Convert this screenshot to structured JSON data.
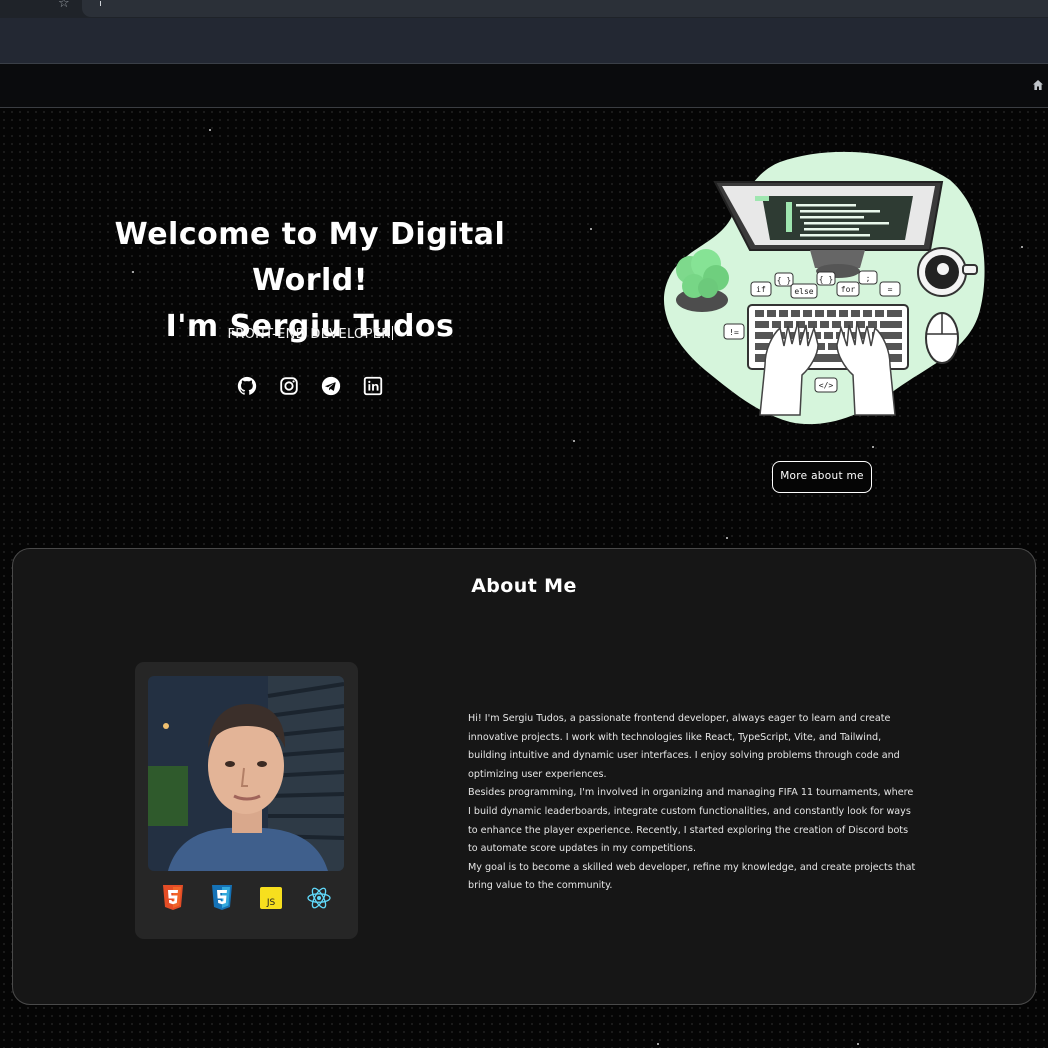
{
  "hero": {
    "title_line1": "Welcome to My Digital World!",
    "title_line2": "I'm Sergiu Tudos",
    "role": "FRONT-END DEVELOPER",
    "more_button": "More about me",
    "socials": [
      "github-icon",
      "instagram-icon",
      "telegram-icon",
      "linkedin-icon"
    ]
  },
  "illustration": {
    "code_words": [
      "{ }",
      "if",
      "else",
      "{ }",
      "for",
      ";",
      "=",
      "!=",
      "</>"
    ]
  },
  "about": {
    "title": "About Me",
    "tech_icons": [
      "html5-icon",
      "css3-icon",
      "javascript-icon",
      "react-icon"
    ],
    "paragraphs": [
      "Hi! I'm Sergiu Tudos, a passionate frontend developer, always eager to learn and create innovative projects. I work with technologies like React, TypeScript, Vite, and Tailwind, building intuitive and dynamic user interfaces. I enjoy solving problems through code and optimizing user experiences.",
      "Besides programming, I'm involved in organizing and managing FIFA 11 tournaments, where I build dynamic leaderboards, integrate custom functionalities, and constantly look for ways to enhance the player experience. Recently, I started exploring the creation of Discord bots to automate score updates in my competitions.",
      "My goal is to become a skilled web developer, refine my knowledge, and create projects that bring value to the community."
    ]
  },
  "colors": {
    "background": "#050505",
    "card": "#161616",
    "illustration_green": "#d6f5dc",
    "html5": "#e44d26",
    "css3": "#1572b6",
    "javascript": "#f7df1e",
    "react": "#61dafb"
  }
}
